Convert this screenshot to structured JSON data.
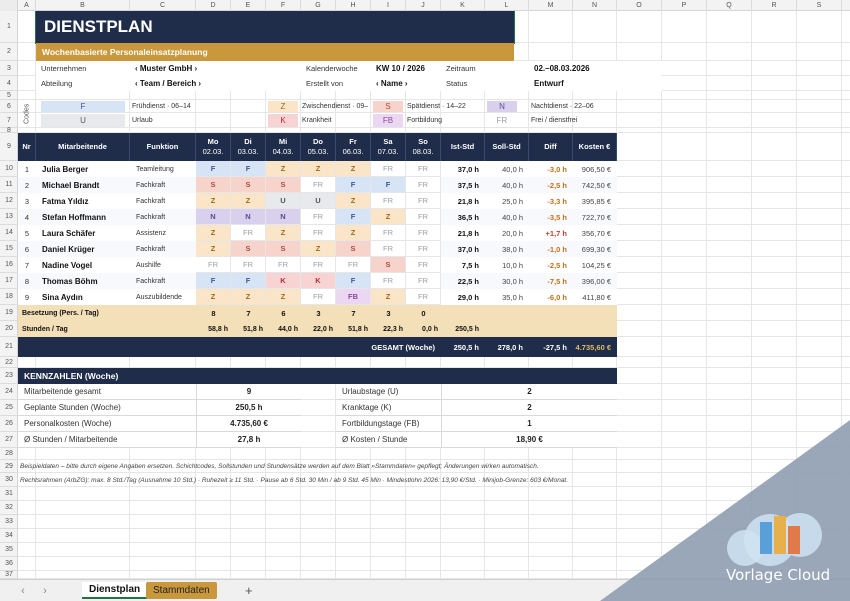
{
  "columns": [
    "A",
    "B",
    "C",
    "D",
    "E",
    "F",
    "G",
    "H",
    "I",
    "J",
    "K",
    "L",
    "M",
    "N",
    "O",
    "P",
    "Q",
    "R",
    "S",
    "T"
  ],
  "rows": [
    "1",
    "2",
    "3",
    "4",
    "5",
    "6",
    "7",
    "8",
    "9",
    "10",
    "11",
    "12",
    "13",
    "14",
    "15",
    "16",
    "17",
    "18",
    "19",
    "20",
    "21",
    "22",
    "23",
    "24",
    "25",
    "26",
    "27",
    "28",
    "29",
    "30",
    "31",
    "32",
    "33",
    "34",
    "35",
    "36",
    "37",
    "38"
  ],
  "title": "DIENSTPLAN",
  "subtitle": "Wochenbasierte Personaleinsatzplanung",
  "info": {
    "company_label": "Unternehmen",
    "company_value": "‹ Muster GmbH ›",
    "week_label": "Kalenderwoche",
    "week_value": "KW 10 / 2026",
    "period_label": "Zeitraum",
    "period_value": "02.–08.03.2026",
    "dept_label": "Abteilung",
    "dept_value": "‹ Team / Bereich ›",
    "creator_label": "Erstellt von",
    "creator_value": "‹ Name ›",
    "status_label": "Status",
    "status_value": "Entwurf"
  },
  "codes_label": "Codes",
  "codes": [
    {
      "code": "F",
      "desc": "Frühdienst · 06–14"
    },
    {
      "code": "Z",
      "desc": "Zwischendienst · 09–"
    },
    {
      "code": "S",
      "desc": "Spätdienst · 14–22"
    },
    {
      "code": "N",
      "desc": "Nachtdienst · 22–06"
    },
    {
      "code": "U",
      "desc": "Urlaub"
    },
    {
      "code": "K",
      "desc": "Krankheit"
    },
    {
      "code": "FB",
      "desc": "Fortbildung"
    },
    {
      "code": "FR",
      "desc": "Frei / dienstfrei"
    }
  ],
  "table_headers": {
    "nr": "Nr",
    "employee": "Mitarbeitende",
    "function": "Funktion",
    "days": [
      {
        "day": "Mo",
        "date": "02.03."
      },
      {
        "day": "Di",
        "date": "03.03."
      },
      {
        "day": "Mi",
        "date": "04.03."
      },
      {
        "day": "Do",
        "date": "05.03."
      },
      {
        "day": "Fr",
        "date": "06.03."
      },
      {
        "day": "Sa",
        "date": "07.03."
      },
      {
        "day": "So",
        "date": "08.03."
      }
    ],
    "ist": "Ist-Std",
    "soll": "Soll-Std",
    "diff": "Diff",
    "cost": "Kosten €"
  },
  "employees": [
    {
      "nr": "1",
      "name": "Julia Berger",
      "func": "Teamleitung",
      "shifts": [
        "F",
        "F",
        "Z",
        "Z",
        "Z",
        "FR",
        "FR"
      ],
      "ist": "37,0 h",
      "soll": "40,0 h",
      "diff": "-3,0 h",
      "cost": "906,50 €"
    },
    {
      "nr": "2",
      "name": "Michael Brandt",
      "func": "Fachkraft",
      "shifts": [
        "S",
        "S",
        "S",
        "FR",
        "F",
        "F",
        "FR"
      ],
      "ist": "37,5 h",
      "soll": "40,0 h",
      "diff": "-2,5 h",
      "cost": "742,50 €"
    },
    {
      "nr": "3",
      "name": "Fatma Yıldız",
      "func": "Fachkraft",
      "shifts": [
        "Z",
        "Z",
        "U",
        "U",
        "Z",
        "FR",
        "FR"
      ],
      "ist": "21,8 h",
      "soll": "25,0 h",
      "diff": "-3,3 h",
      "cost": "395,85 €"
    },
    {
      "nr": "4",
      "name": "Stefan Hoffmann",
      "func": "Fachkraft",
      "shifts": [
        "N",
        "N",
        "N",
        "FR",
        "F",
        "Z",
        "FR"
      ],
      "ist": "36,5 h",
      "soll": "40,0 h",
      "diff": "-3,5 h",
      "cost": "722,70 €"
    },
    {
      "nr": "5",
      "name": "Laura Schäfer",
      "func": "Assistenz",
      "shifts": [
        "Z",
        "FR",
        "Z",
        "FR",
        "Z",
        "FR",
        "FR"
      ],
      "ist": "21,8 h",
      "soll": "20,0 h",
      "diff": "+1,7 h",
      "cost": "356,70 €"
    },
    {
      "nr": "6",
      "name": "Daniel Krüger",
      "func": "Fachkraft",
      "shifts": [
        "Z",
        "S",
        "S",
        "Z",
        "S",
        "FR",
        "FR"
      ],
      "ist": "37,0 h",
      "soll": "38,0 h",
      "diff": "-1,0 h",
      "cost": "699,30 €"
    },
    {
      "nr": "7",
      "name": "Nadine Vogel",
      "func": "Aushilfe",
      "shifts": [
        "FR",
        "FR",
        "FR",
        "FR",
        "FR",
        "S",
        "FR"
      ],
      "ist": "7,5 h",
      "soll": "10,0 h",
      "diff": "-2,5 h",
      "cost": "104,25 €"
    },
    {
      "nr": "8",
      "name": "Thomas Böhm",
      "func": "Fachkraft",
      "shifts": [
        "F",
        "F",
        "K",
        "K",
        "F",
        "FR",
        "FR"
      ],
      "ist": "22,5 h",
      "soll": "30,0 h",
      "diff": "-7,5 h",
      "cost": "396,00 €"
    },
    {
      "nr": "9",
      "name": "Sina Aydın",
      "func": "Auszubildende",
      "shifts": [
        "Z",
        "Z",
        "Z",
        "FR",
        "FB",
        "Z",
        "FR"
      ],
      "ist": "29,0 h",
      "soll": "35,0 h",
      "diff": "-6,0 h",
      "cost": "411,80 €"
    }
  ],
  "staffing_label": "Besetzung (Pers. / Tag)",
  "staffing": [
    "8",
    "7",
    "6",
    "3",
    "7",
    "3",
    "0"
  ],
  "hours_label": "Stunden / Tag",
  "hours": [
    "58,8 h",
    "51,8 h",
    "44,0 h",
    "22,0 h",
    "51,8 h",
    "22,3 h",
    "0,0 h"
  ],
  "hours_total": "250,5 h",
  "total": {
    "label": "GESAMT (Woche)",
    "ist": "250,5 h",
    "soll": "278,0 h",
    "diff": "-27,5 h",
    "cost": "4.735,60 €"
  },
  "kpi": {
    "title": "KENNZAHLEN (Woche)",
    "left": [
      {
        "label": "Mitarbeitende gesamt",
        "value": "9"
      },
      {
        "label": "Geplante Stunden (Woche)",
        "value": "250,5 h"
      },
      {
        "label": "Personalkosten (Woche)",
        "value": "4.735,60 €"
      },
      {
        "label": "Ø Stunden / Mitarbeitende",
        "value": "27,8 h"
      }
    ],
    "right": [
      {
        "label": "Urlaubstage (U)",
        "value": "2"
      },
      {
        "label": "Kranktage (K)",
        "value": "2"
      },
      {
        "label": "Fortbildungstage (FB)",
        "value": "1"
      },
      {
        "label": "Ø Kosten / Stunde",
        "value": "18,90 €"
      }
    ]
  },
  "notes": [
    "Beispieldaten – bitte durch eigene Angaben ersetzen. Schichtcodes, Sollstunden und Stundensätze werden auf dem Blatt »Stammdaten« gepflegt; Änderungen wirken automatisch.",
    "Rechtsrahmen (ArbZG): max. 8 Std./Tag (Ausnahme 10 Std.) · Ruhezeit ≥ 11 Std. · Pause ab 6 Std. 30 Min / ab 9 Std. 45 Min · Mindestlohn 2026: 13,90 €/Std. · Minijob-Grenze: 603 €/Monat."
  ],
  "sheet_tabs": [
    "Dienstplan",
    "Stammdaten"
  ],
  "watermark": "Vorlage Cloud",
  "colors": {
    "navy": "#1f2d4a",
    "gold": "#c9983c",
    "excel_green": "#217346"
  }
}
